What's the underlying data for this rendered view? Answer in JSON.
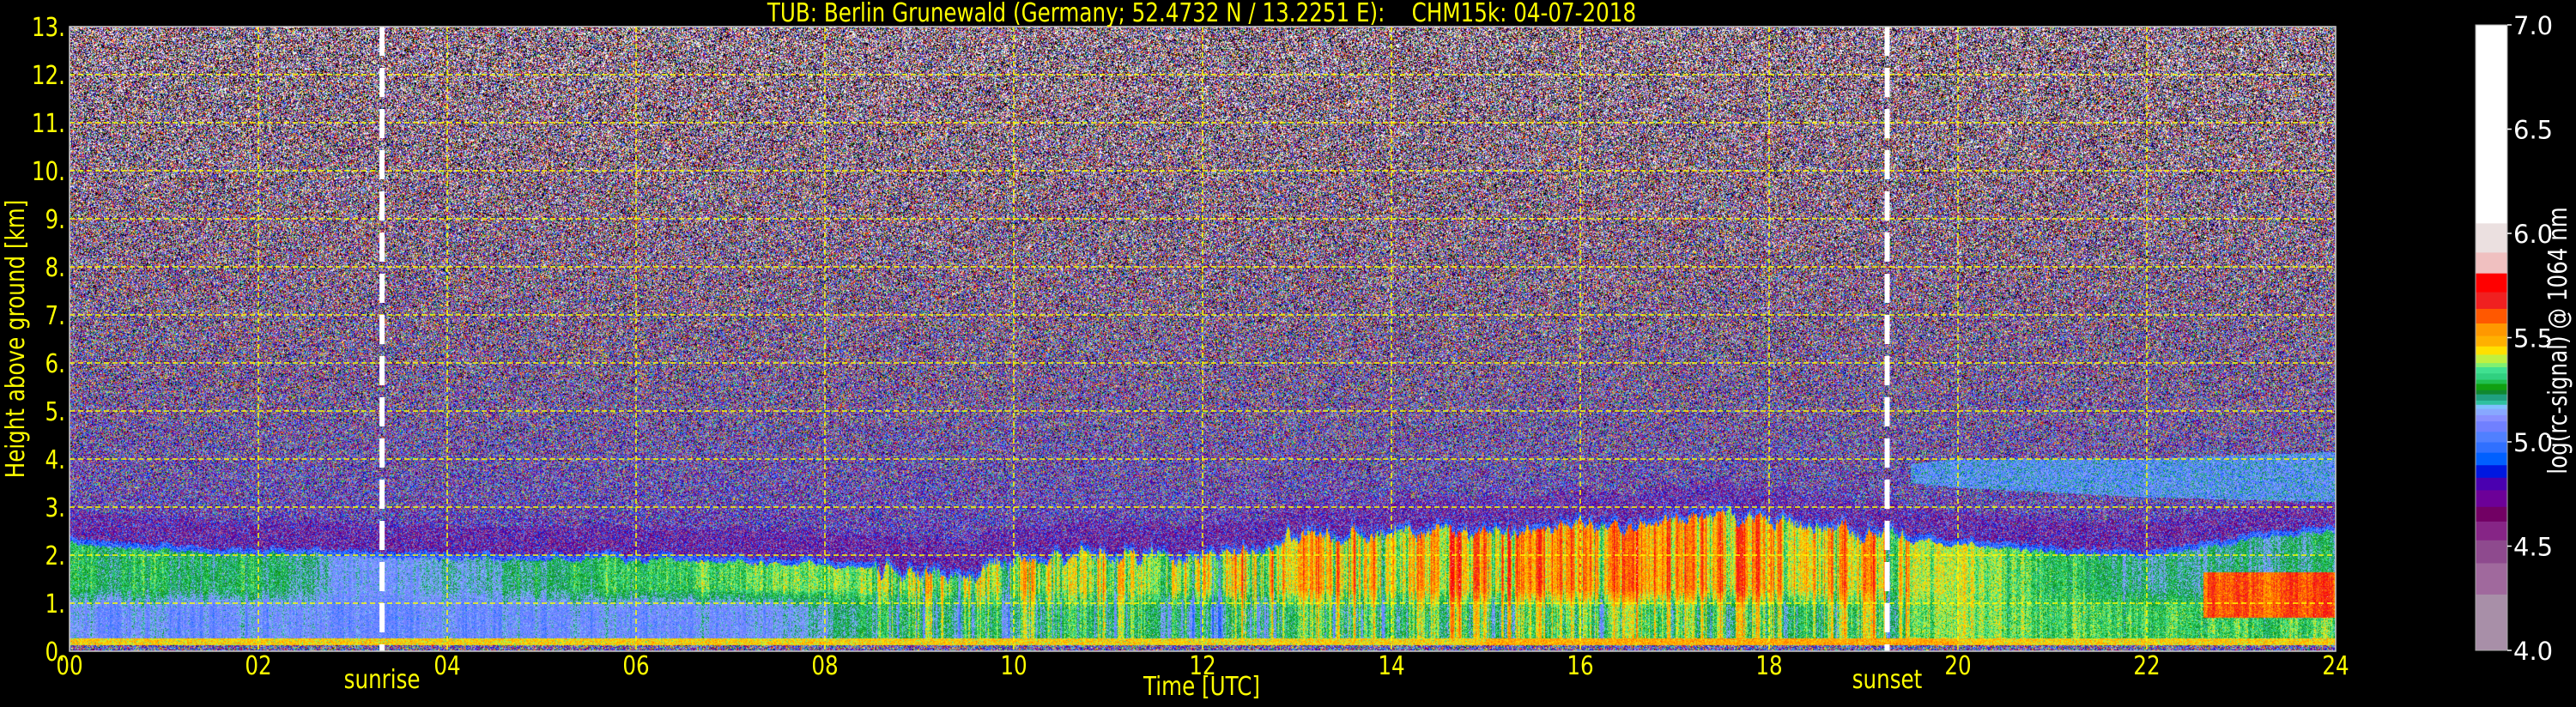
{
  "chart_data": {
    "type": "heatmap",
    "title": "TUB: Berlin Grunewald (Germany; 52.4732 N / 13.2251 E):    CHM15k: 04-07-2018",
    "xlabel": "Time [UTC]",
    "ylabel": "Height above ground [km]",
    "xlim": [
      0,
      24
    ],
    "ylim": [
      0,
      13
    ],
    "grid": true,
    "xticks": [
      0,
      2,
      4,
      6,
      8,
      10,
      12,
      14,
      16,
      18,
      20,
      22,
      24
    ],
    "xtick_labels": [
      "00",
      "02",
      "04",
      "06",
      "08",
      "10",
      "12",
      "14",
      "16",
      "18",
      "20",
      "22",
      "24"
    ],
    "yticks": [
      0,
      1,
      2,
      3,
      4,
      5,
      6,
      7,
      8,
      9,
      10,
      11,
      12,
      13
    ],
    "ytick_labels": [
      "0.",
      "1.",
      "2.",
      "3.",
      "4.",
      "5.",
      "6.",
      "7.",
      "8.",
      "9.",
      "10.",
      "11.",
      "12.",
      "13."
    ],
    "annotations": [
      {
        "label": "sunrise",
        "time": 3.31
      },
      {
        "label": "sunset",
        "time": 19.25
      }
    ],
    "colorbar": {
      "label": "log(rc-signal) @ 1064 nm",
      "range": [
        4.0,
        7.0
      ],
      "ticks": [
        4.0,
        4.5,
        5.0,
        5.5,
        6.0,
        6.5,
        7.0
      ],
      "tick_labels": [
        "4.0",
        "4.5",
        "5.0",
        "5.5",
        "6.0",
        "6.5",
        "7.0"
      ],
      "bands": [
        {
          "min": 4.0,
          "color": "#a88fa8"
        },
        {
          "min": 4.27,
          "color": "#a0699d"
        },
        {
          "min": 4.42,
          "color": "#8e4a8e"
        },
        {
          "min": 4.53,
          "color": "#862586"
        },
        {
          "min": 4.62,
          "color": "#720064"
        },
        {
          "min": 4.69,
          "color": "#6c0098"
        },
        {
          "min": 4.77,
          "color": "#4a00b0"
        },
        {
          "min": 4.83,
          "color": "#0018e0"
        },
        {
          "min": 4.89,
          "color": "#0060ff"
        },
        {
          "min": 4.95,
          "color": "#3070ff"
        },
        {
          "min": 5.0,
          "color": "#5080ff"
        },
        {
          "min": 5.05,
          "color": "#7080ff"
        },
        {
          "min": 5.1,
          "color": "#8890ff"
        },
        {
          "min": 5.13,
          "color": "#88a8ff"
        },
        {
          "min": 5.16,
          "color": "#80c0ff"
        },
        {
          "min": 5.18,
          "color": "#30c0a0"
        },
        {
          "min": 5.2,
          "color": "#20a080"
        },
        {
          "min": 5.23,
          "color": "#108830"
        },
        {
          "min": 5.25,
          "color": "#10a010"
        },
        {
          "min": 5.28,
          "color": "#20c050"
        },
        {
          "min": 5.3,
          "color": "#30d080"
        },
        {
          "min": 5.33,
          "color": "#40e090"
        },
        {
          "min": 5.36,
          "color": "#80f070"
        },
        {
          "min": 5.38,
          "color": "#c0f040"
        },
        {
          "min": 5.42,
          "color": "#ffe000"
        },
        {
          "min": 5.46,
          "color": "#ffb000"
        },
        {
          "min": 5.51,
          "color": "#ff9800"
        },
        {
          "min": 5.57,
          "color": "#ff5800"
        },
        {
          "min": 5.64,
          "color": "#f02020"
        },
        {
          "min": 5.72,
          "color": "#ff0000"
        },
        {
          "min": 5.81,
          "color": "#f0c0c0"
        },
        {
          "min": 5.91,
          "color": "#ebe0e0"
        },
        {
          "min": 6.05,
          "color": "#ffffff"
        }
      ]
    },
    "layers": {
      "mixing_layer_top_km": [
        [
          0,
          2.2
        ],
        [
          2,
          2.0
        ],
        [
          4,
          1.95
        ],
        [
          6,
          1.9
        ],
        [
          8,
          1.8
        ],
        [
          9.5,
          1.6
        ],
        [
          10,
          1.85
        ],
        [
          11,
          2.0
        ],
        [
          12,
          1.95
        ],
        [
          13,
          2.3
        ],
        [
          14,
          2.45
        ],
        [
          16,
          2.6
        ],
        [
          17,
          2.7
        ],
        [
          18,
          2.75
        ],
        [
          19,
          2.5
        ],
        [
          19.3,
          2.4
        ],
        [
          20,
          2.2
        ],
        [
          21,
          2.05
        ],
        [
          22,
          1.95
        ],
        [
          23,
          2.3
        ],
        [
          24,
          2.5
        ]
      ],
      "upper_layer_value": [
        [
          0,
          5.27
        ],
        [
          2,
          5.25
        ],
        [
          3,
          5.12
        ],
        [
          4,
          5.15
        ],
        [
          6,
          5.3
        ],
        [
          8,
          5.35
        ],
        [
          10,
          5.38
        ],
        [
          12,
          5.36
        ],
        [
          13,
          5.45
        ],
        [
          14,
          5.47
        ],
        [
          16,
          5.52
        ],
        [
          18,
          5.5
        ],
        [
          19,
          5.45
        ],
        [
          20,
          5.4
        ],
        [
          21,
          5.3
        ],
        [
          22,
          5.2
        ],
        [
          24,
          5.2
        ]
      ],
      "lower_layer_value": [
        [
          0,
          5.1
        ],
        [
          4,
          5.08
        ],
        [
          7.5,
          5.1
        ],
        [
          8.5,
          5.25
        ],
        [
          11.5,
          5.26
        ],
        [
          12,
          5.12
        ],
        [
          12.5,
          5.25
        ],
        [
          14,
          5.33
        ],
        [
          17,
          5.32
        ],
        [
          19,
          5.33
        ],
        [
          20,
          5.38
        ],
        [
          21,
          5.32
        ],
        [
          24,
          5.3
        ]
      ],
      "elevated_layer_km": [
        [
          19.5,
          3.5,
          3.9
        ],
        [
          20,
          3.4,
          4.0
        ],
        [
          22,
          3.2,
          4.0
        ],
        [
          24,
          3.1,
          4.15
        ]
      ],
      "elevated_layer_value": 5.1,
      "evening_plume": {
        "time": [
          22.6,
          24
        ],
        "height_km": [
          0.7,
          1.65
        ],
        "value": 5.6
      },
      "surface_layer_value": 5.45
    }
  }
}
